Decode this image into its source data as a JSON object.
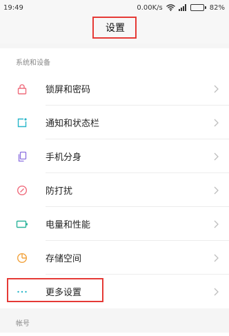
{
  "status_bar": {
    "time": "19:49",
    "net_speed": "0.00K/s",
    "battery": "82%",
    "battery_level": 0.82
  },
  "title_bar": {
    "title": "设置"
  },
  "sections": {
    "system": {
      "label": "系统和设备"
    },
    "account": {
      "label": "帐号"
    }
  },
  "items": [
    {
      "label": "锁屏和密码",
      "icon": "lock-icon",
      "color": "#ef6b7c"
    },
    {
      "label": "通知和状态栏",
      "icon": "notification-icon",
      "color": "#27b6c9"
    },
    {
      "label": "手机分身",
      "icon": "dual-phone-icon",
      "color": "#8b6fe0"
    },
    {
      "label": "防打扰",
      "icon": "do-not-disturb-icon",
      "color": "#ef6b7c"
    },
    {
      "label": "电量和性能",
      "icon": "battery-icon",
      "color": "#2ab39a"
    },
    {
      "label": "存储空间",
      "icon": "storage-icon",
      "color": "#f2a23c"
    },
    {
      "label": "更多设置",
      "icon": "more-icon",
      "color": "#27b6c9"
    }
  ]
}
